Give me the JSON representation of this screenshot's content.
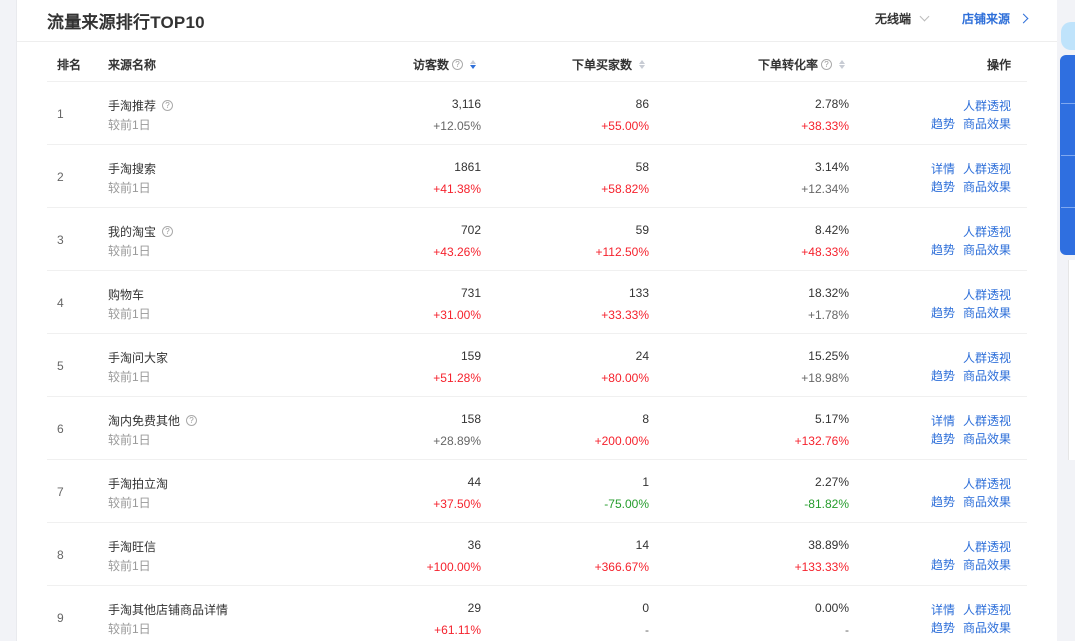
{
  "header": {
    "title": "流量来源排行TOP10",
    "device_dropdown": "无线端",
    "shop_source_link": "店铺来源"
  },
  "table": {
    "columns": {
      "rank": "排名",
      "source": "来源名称",
      "visitors": "访客数",
      "buyers": "下单买家数",
      "conversion": "下单转化率",
      "actions": "操作"
    },
    "compare_label": "较前1日",
    "action_labels": {
      "detail": "详情",
      "crowd": "人群透视",
      "trend": "趋势",
      "product": "商品效果"
    },
    "rows": [
      {
        "rank": "1",
        "name": "手淘推荐",
        "help": true,
        "visitors": "3,116",
        "visitors_change": "+12.05%",
        "visitors_color": "gray",
        "buyers": "86",
        "buyers_change": "+55.00%",
        "buyers_color": "red",
        "rate": "2.78%",
        "rate_change": "+38.33%",
        "rate_color": "red",
        "detail": false
      },
      {
        "rank": "2",
        "name": "手淘搜索",
        "help": false,
        "visitors": "1861",
        "visitors_change": "+41.38%",
        "visitors_color": "red",
        "buyers": "58",
        "buyers_change": "+58.82%",
        "buyers_color": "red",
        "rate": "3.14%",
        "rate_change": "+12.34%",
        "rate_color": "gray",
        "detail": true
      },
      {
        "rank": "3",
        "name": "我的淘宝",
        "help": true,
        "visitors": "702",
        "visitors_change": "+43.26%",
        "visitors_color": "red",
        "buyers": "59",
        "buyers_change": "+112.50%",
        "buyers_color": "red",
        "rate": "8.42%",
        "rate_change": "+48.33%",
        "rate_color": "red",
        "detail": false
      },
      {
        "rank": "4",
        "name": "购物车",
        "help": false,
        "visitors": "731",
        "visitors_change": "+31.00%",
        "visitors_color": "red",
        "buyers": "133",
        "buyers_change": "+33.33%",
        "buyers_color": "red",
        "rate": "18.32%",
        "rate_change": "+1.78%",
        "rate_color": "gray",
        "detail": false
      },
      {
        "rank": "5",
        "name": "手淘问大家",
        "help": false,
        "visitors": "159",
        "visitors_change": "+51.28%",
        "visitors_color": "red",
        "buyers": "24",
        "buyers_change": "+80.00%",
        "buyers_color": "red",
        "rate": "15.25%",
        "rate_change": "+18.98%",
        "rate_color": "gray",
        "detail": false
      },
      {
        "rank": "6",
        "name": "淘内免费其他",
        "help": true,
        "visitors": "158",
        "visitors_change": "+28.89%",
        "visitors_color": "gray",
        "buyers": "8",
        "buyers_change": "+200.00%",
        "buyers_color": "red",
        "rate": "5.17%",
        "rate_change": "+132.76%",
        "rate_color": "red",
        "detail": true
      },
      {
        "rank": "7",
        "name": "手淘拍立淘",
        "help": false,
        "visitors": "44",
        "visitors_change": "+37.50%",
        "visitors_color": "red",
        "buyers": "1",
        "buyers_change": "-75.00%",
        "buyers_color": "green",
        "rate": "2.27%",
        "rate_change": "-81.82%",
        "rate_color": "green",
        "detail": false
      },
      {
        "rank": "8",
        "name": "手淘旺信",
        "help": false,
        "visitors": "36",
        "visitors_change": "+100.00%",
        "visitors_color": "red",
        "buyers": "14",
        "buyers_change": "+366.67%",
        "buyers_color": "red",
        "rate": "38.89%",
        "rate_change": "+133.33%",
        "rate_color": "red",
        "detail": false
      },
      {
        "rank": "9",
        "name": "手淘其他店铺商品详情",
        "help": false,
        "visitors": "29",
        "visitors_change": "+61.11%",
        "visitors_color": "red",
        "buyers": "0",
        "buyers_change": "-",
        "buyers_color": "gray",
        "rate": "0.00%",
        "rate_change": "-",
        "rate_color": "gray",
        "detail": true
      }
    ]
  },
  "colors": {
    "accent": "#2e6fd9",
    "up": "#f5222d",
    "down": "#259c2c",
    "neutral": "#666666"
  }
}
